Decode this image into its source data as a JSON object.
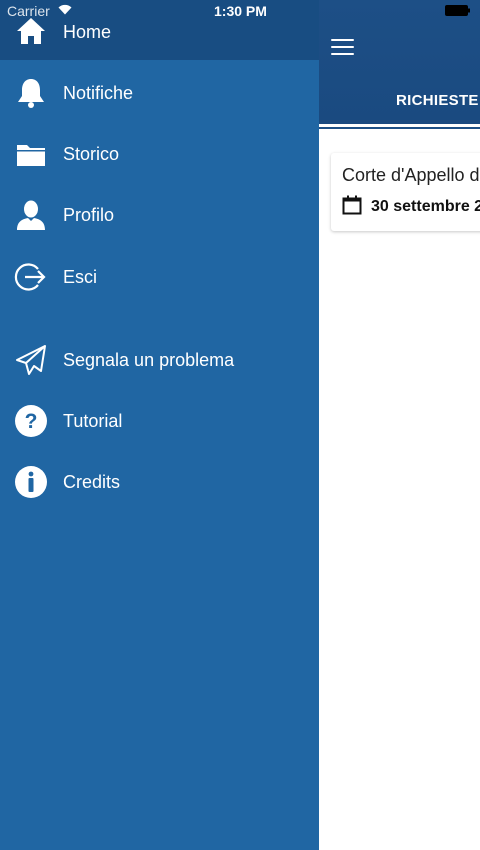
{
  "status_bar": {
    "carrier": "Carrier",
    "time": "1:30 PM"
  },
  "drawer": {
    "background": "#2066a3",
    "home_background": "#184d82",
    "items": [
      {
        "label": "Home",
        "icon": "home-icon"
      },
      {
        "label": "Notifiche",
        "icon": "bell-icon"
      },
      {
        "label": "Storico",
        "icon": "folder-icon"
      },
      {
        "label": "Profilo",
        "icon": "user-icon"
      },
      {
        "label": "Esci",
        "icon": "logout-icon"
      },
      {
        "label": "Segnala un problema",
        "icon": "paper-plane-icon"
      },
      {
        "label": "Tutorial",
        "icon": "question-circle-icon"
      },
      {
        "label": "Credits",
        "icon": "info-circle-icon"
      }
    ]
  },
  "main": {
    "header_color": "#1d4f86",
    "tab": {
      "label": "RICHIESTE"
    },
    "card": {
      "title": "Corte d'Appello d",
      "date": "30 settembre 2"
    }
  }
}
